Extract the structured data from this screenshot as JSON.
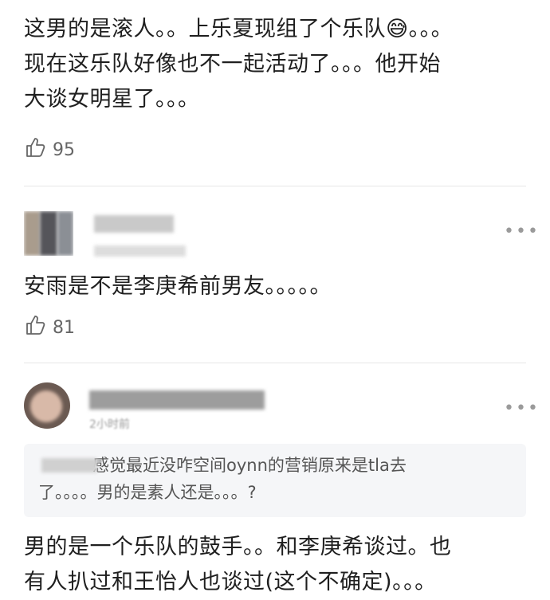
{
  "comments": [
    {
      "text_lines": [
        "这男的是滚人。。上乐夏现组了个乐队😅。。。",
        "现在这乐队好像也不一起活动了。。。他开始",
        "大谈女明星了。。。"
      ],
      "likes": "95"
    },
    {
      "text": "安雨是不是李庚希前男友。。。。。",
      "likes": "81",
      "more": "•••"
    },
    {
      "time_fragment": "2小时前",
      "quote_lines": [
        "感觉最近没咋空间oynn的营销原来是tla去",
        "了。。。。男的是素人还是。。。?"
      ],
      "text_lines": [
        "男的是一个乐队的鼓手。。和李庚希谈过。也",
        "有人扒过和王怡人也谈过(这个不确定)。。。"
      ],
      "more": "•••"
    }
  ],
  "icons": [
    "thumbs-up-icon",
    "more-icon"
  ]
}
